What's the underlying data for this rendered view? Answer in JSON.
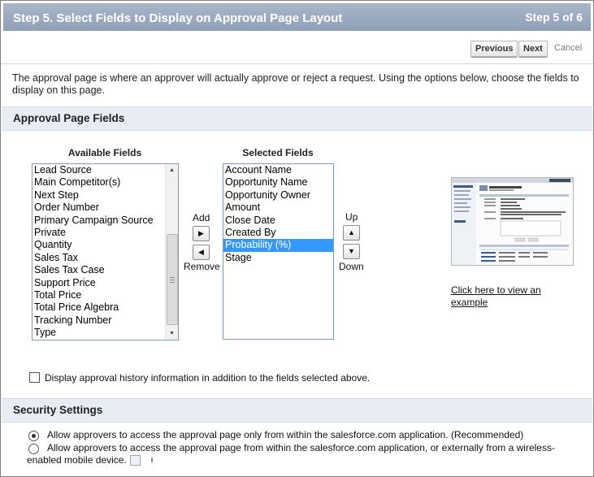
{
  "header": {
    "title": "Step 5. Select Fields to Display on Approval Page Layout",
    "step": "Step 5 of 6"
  },
  "nav": {
    "previous": "Previous",
    "next": "Next",
    "cancel": "Cancel"
  },
  "intro": "The approval page is where an approver will actually approve or reject a request. Using the options below, choose the fields to display on this page.",
  "approval_section": {
    "heading": "Approval Page Fields",
    "available_title": "Available Fields",
    "selected_title": "Selected Fields",
    "available_fields": [
      "Lead Source",
      "Main Competitor(s)",
      "Next Step",
      "Order Number",
      "Primary Campaign Source",
      "Private",
      "Quantity",
      "Sales Tax",
      "Sales Tax Case",
      "Support Price",
      "Total Price",
      "Total Price Algebra",
      "Tracking Number",
      "Type"
    ],
    "selected_fields": [
      "Account Name",
      "Opportunity Name",
      "Opportunity Owner",
      "Amount",
      "Close Date",
      "Created By",
      "Probability (%)",
      "Stage"
    ],
    "selected_highlight": "Probability (%)",
    "add_label": "Add",
    "remove_label": "Remove",
    "up_label": "Up",
    "down_label": "Down",
    "example_link": "Click here to view an example",
    "history_checkbox_label": "Display approval history information in addition to the fields selected above.",
    "history_checked": false
  },
  "security_section": {
    "heading": "Security Settings",
    "options": [
      {
        "label": "Allow approvers to access the approval page only from within the salesforce.com application. (Recommended)",
        "selected": true
      },
      {
        "label": "Allow approvers to access the approval page from within the salesforce.com application, or externally from a wireless-enabled mobile device.",
        "selected": false
      }
    ],
    "info_icon": "i"
  },
  "colors": {
    "header_bg": "#99a8bf",
    "section_bg": "#e8edf3",
    "list_highlight": "#3399ff"
  }
}
